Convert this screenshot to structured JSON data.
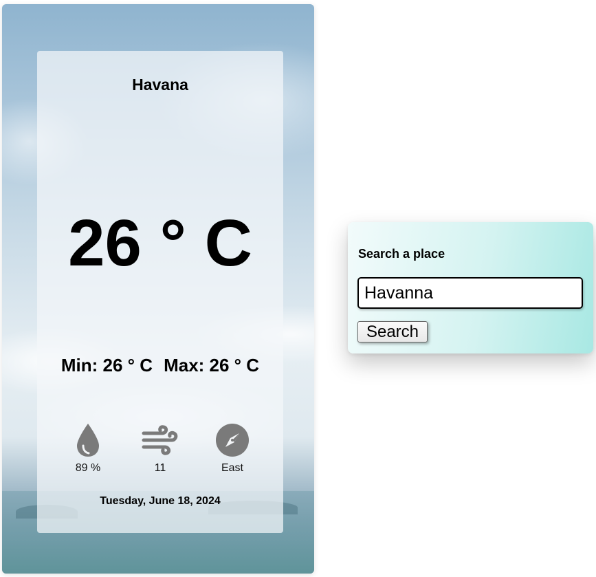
{
  "weather": {
    "city": "Havana",
    "temperature": "26 ° C",
    "min_label": "Min: 26 ° C",
    "max_label": "Max: 26 ° C",
    "humidity": "89 %",
    "wind": "11",
    "direction": "East",
    "date": "Tuesday, June 18, 2024",
    "icons": {
      "humidity": "water-drop-icon",
      "wind": "wind-icon",
      "direction": "compass-icon"
    },
    "icon_color": "#7a7a7a"
  },
  "search": {
    "title": "Search a place",
    "input_value": "Havanna",
    "button_label": "Search"
  }
}
